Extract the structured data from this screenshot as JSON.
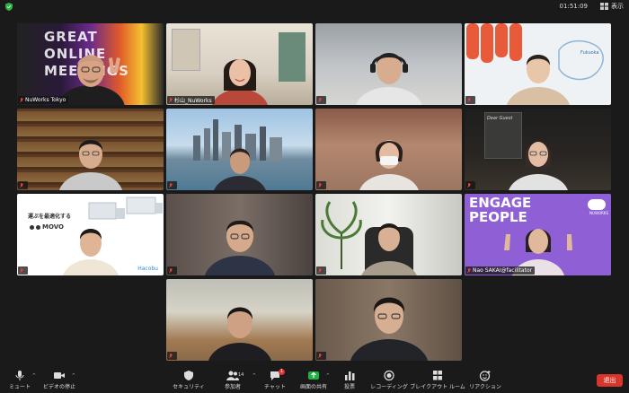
{
  "window": {
    "clock": "01:51:09",
    "view_label": "表示"
  },
  "participants": [
    {
      "name": "NuWorks Tokyo",
      "bg_text": "GREAT ONLINE MEETINGS"
    },
    {
      "name": "杉山_NuWorks"
    },
    {
      "name": ""
    },
    {
      "name": "",
      "bg_text": "Fukuoka"
    },
    {
      "name": ""
    },
    {
      "name": ""
    },
    {
      "name": ""
    },
    {
      "name": "",
      "bg_text": "Dear Guest"
    },
    {
      "name": "",
      "bg_text_1": "運ぶを最適化する",
      "bg_text_2": "MOVO",
      "bg_text_3": "Hacobu"
    },
    {
      "name": ""
    },
    {
      "name": ""
    },
    {
      "name": "Nao SAKAI@facilitator",
      "bg_text_1": "ENGAGE",
      "bg_text_2": "PEOPLE",
      "bg_text_3": "NUWORKS"
    },
    {
      "name": ""
    },
    {
      "name": ""
    }
  ],
  "toolbar": {
    "mute": "ミュート",
    "video": "ビデオの停止",
    "security": "セキュリティ",
    "participants": "参加者",
    "participants_count": "14",
    "chat": "チャット",
    "chat_badge": "1",
    "share": "画面の共有",
    "polls": "投票",
    "record": "レコーディング",
    "breakout": "ブレイクアウト ルーム",
    "reactions": "リアクション",
    "end": "退出"
  },
  "colors": {
    "active_speaker": "#3ccc4a",
    "share_green": "#1fb141",
    "end_red": "#d9362b"
  }
}
